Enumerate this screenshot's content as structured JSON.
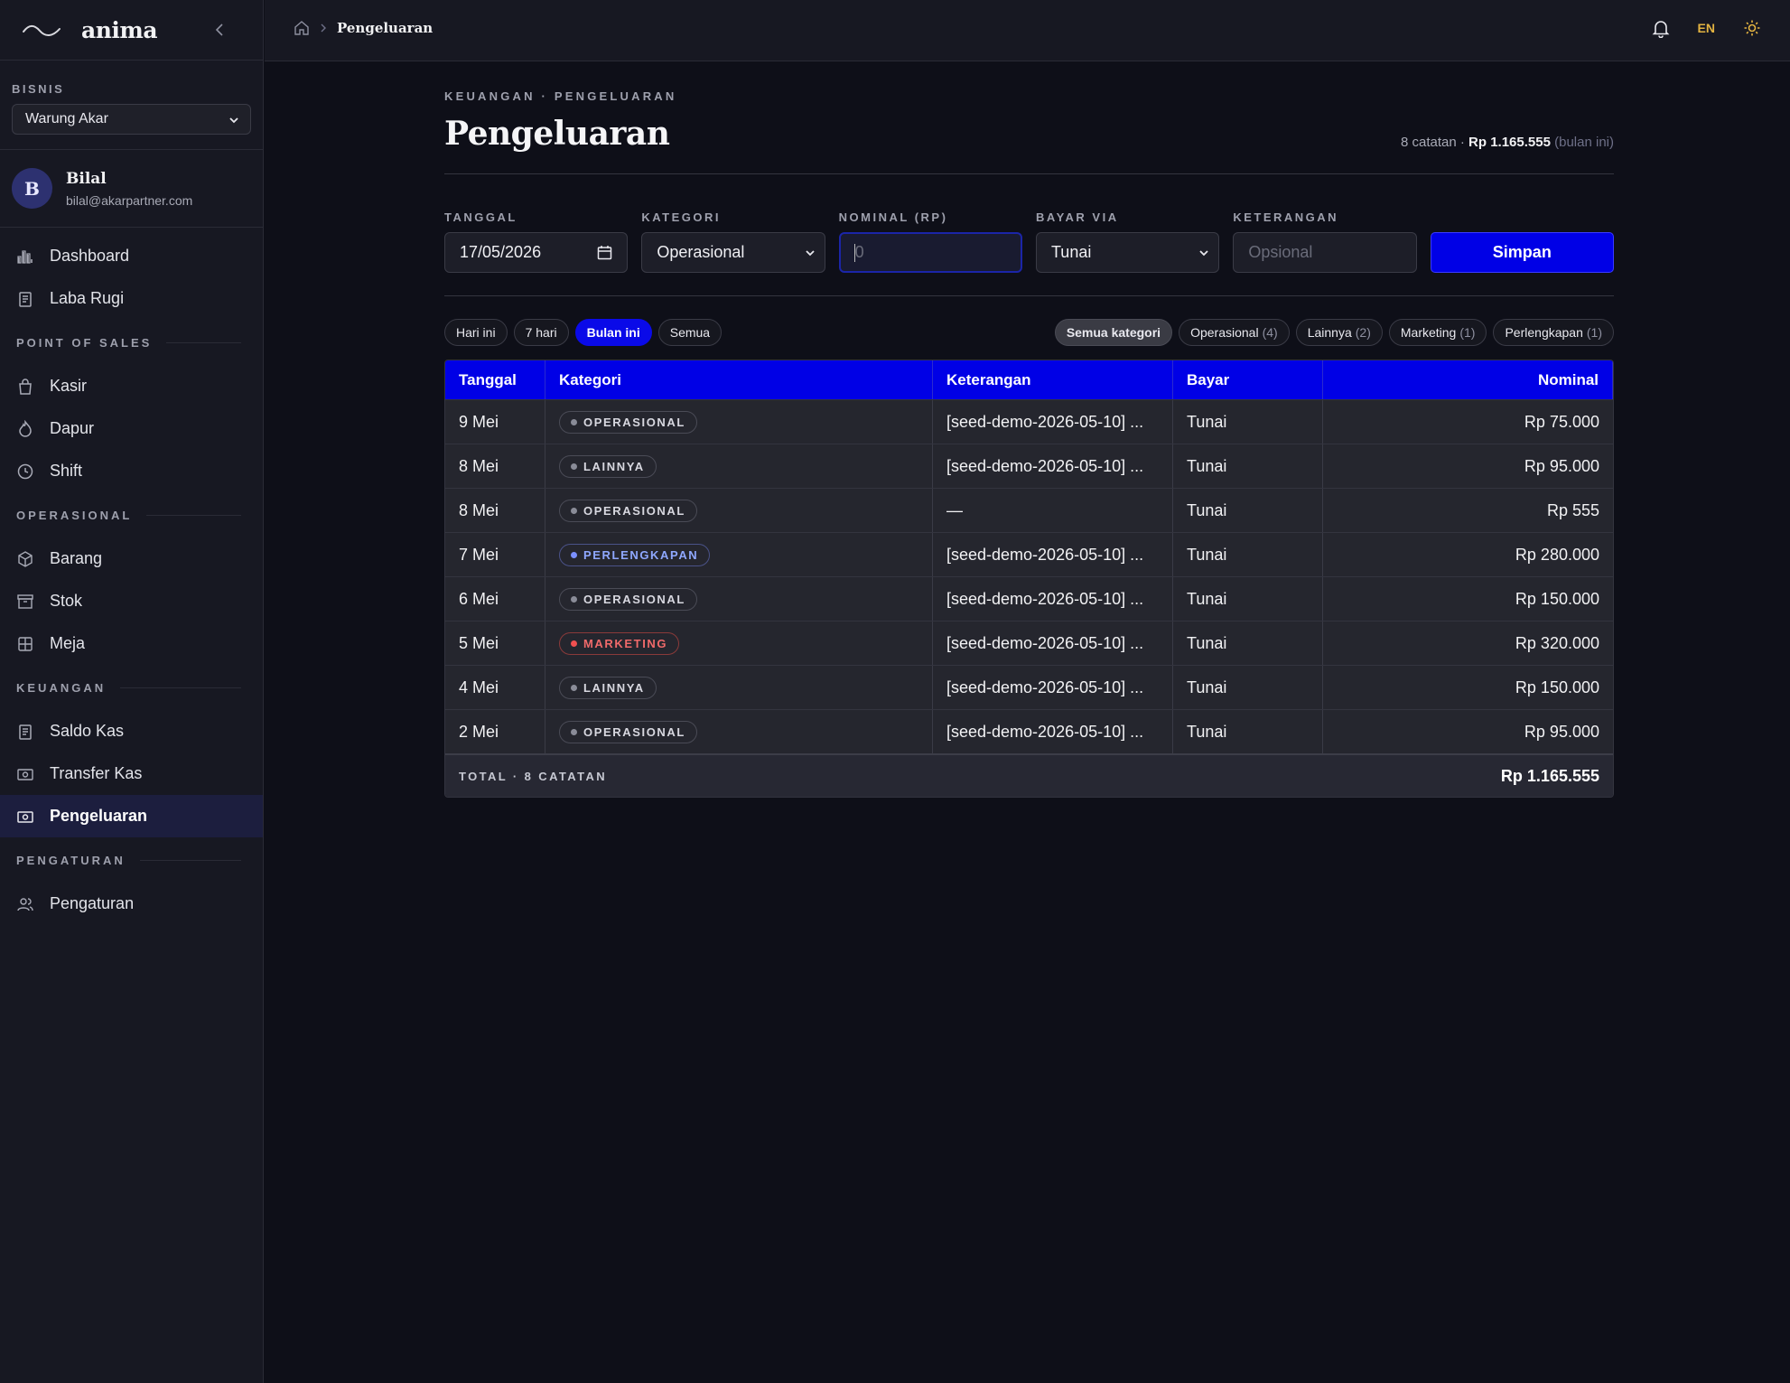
{
  "app": {
    "brand": "anima"
  },
  "sidebar": {
    "business_label": "BISNIS",
    "business_selected": "Warung Akar",
    "user": {
      "initial": "B",
      "name": "Bilal",
      "email": "bilal@akarpartner.com"
    },
    "top_items": [
      {
        "label": "Dashboard",
        "icon": "bar-chart-icon"
      },
      {
        "label": "Laba Rugi",
        "icon": "receipt-icon"
      }
    ],
    "sections": [
      {
        "title": "POINT OF SALES",
        "items": [
          {
            "label": "Kasir",
            "icon": "shopping-bag-icon"
          },
          {
            "label": "Dapur",
            "icon": "flame-icon"
          },
          {
            "label": "Shift",
            "icon": "clock-icon"
          }
        ]
      },
      {
        "title": "OPERASIONAL",
        "items": [
          {
            "label": "Barang",
            "icon": "box-icon"
          },
          {
            "label": "Stok",
            "icon": "archive-icon"
          },
          {
            "label": "Meja",
            "icon": "grid-icon"
          }
        ]
      },
      {
        "title": "KEUANGAN",
        "items": [
          {
            "label": "Saldo Kas",
            "icon": "receipt-icon"
          },
          {
            "label": "Transfer Kas",
            "icon": "banknote-icon"
          },
          {
            "label": "Pengeluaran",
            "icon": "banknote-icon",
            "active": true
          }
        ]
      },
      {
        "title": "PENGATURAN",
        "items": [
          {
            "label": "Pengaturan",
            "icon": "users-icon"
          }
        ]
      }
    ]
  },
  "topbar": {
    "breadcrumb_current": "Pengeluaran",
    "language": "EN"
  },
  "page": {
    "eyebrow": "KEUANGAN · PENGELUARAN",
    "title": "Pengeluaran",
    "summary_count": "8 catatan · ",
    "summary_amount": "Rp 1.165.555",
    "summary_period": "(bulan ini)"
  },
  "form": {
    "date": {
      "label": "TANGGAL",
      "value": "17/05/2026"
    },
    "category": {
      "label": "KATEGORI",
      "value": "Operasional"
    },
    "amount": {
      "label": "NOMINAL (RP)",
      "placeholder": "0"
    },
    "pay_via": {
      "label": "BAYAR VIA",
      "value": "Tunai"
    },
    "note": {
      "label": "KETERANGAN",
      "placeholder": "Opsional"
    },
    "submit": "Simpan"
  },
  "period_filters": [
    {
      "label": "Hari ini"
    },
    {
      "label": "7 hari"
    },
    {
      "label": "Bulan ini",
      "active": true
    },
    {
      "label": "Semua"
    }
  ],
  "category_filters": [
    {
      "label": "Semua kategori",
      "active": true
    },
    {
      "label": "Operasional",
      "count": "(4)"
    },
    {
      "label": "Lainnya",
      "count": "(2)"
    },
    {
      "label": "Marketing",
      "count": "(1)"
    },
    {
      "label": "Perlengkapan",
      "count": "(1)"
    }
  ],
  "table": {
    "columns": [
      "Tanggal",
      "Kategori",
      "Keterangan",
      "Bayar",
      "Nominal"
    ],
    "rows": [
      {
        "date": "9 Mei",
        "category": "OPERASIONAL",
        "tone": "gray",
        "note": "[seed-demo-2026-05-10] ...",
        "pay": "Tunai",
        "amount": "Rp 75.000"
      },
      {
        "date": "8 Mei",
        "category": "LAINNYA",
        "tone": "gray",
        "note": "[seed-demo-2026-05-10] ...",
        "pay": "Tunai",
        "amount": "Rp 95.000"
      },
      {
        "date": "8 Mei",
        "category": "OPERASIONAL",
        "tone": "gray",
        "note": "—",
        "pay": "Tunai",
        "amount": "Rp 555"
      },
      {
        "date": "7 Mei",
        "category": "PERLENGKAPAN",
        "tone": "blue",
        "note": "[seed-demo-2026-05-10] ...",
        "pay": "Tunai",
        "amount": "Rp 280.000"
      },
      {
        "date": "6 Mei",
        "category": "OPERASIONAL",
        "tone": "gray",
        "note": "[seed-demo-2026-05-10] ...",
        "pay": "Tunai",
        "amount": "Rp 150.000"
      },
      {
        "date": "5 Mei",
        "category": "MARKETING",
        "tone": "red",
        "note": "[seed-demo-2026-05-10] ...",
        "pay": "Tunai",
        "amount": "Rp 320.000"
      },
      {
        "date": "4 Mei",
        "category": "LAINNYA",
        "tone": "gray",
        "note": "[seed-demo-2026-05-10] ...",
        "pay": "Tunai",
        "amount": "Rp 150.000"
      },
      {
        "date": "2 Mei",
        "category": "OPERASIONAL",
        "tone": "gray",
        "note": "[seed-demo-2026-05-10] ...",
        "pay": "Tunai",
        "amount": "Rp 95.000"
      }
    ],
    "footer_label": "TOTAL · 8 CATATAN",
    "footer_total": "Rp 1.165.555"
  },
  "colors": {
    "accent": "#0000e6",
    "background": "#0e0f18",
    "sidebar": "#171822",
    "language": "#e3b341"
  }
}
